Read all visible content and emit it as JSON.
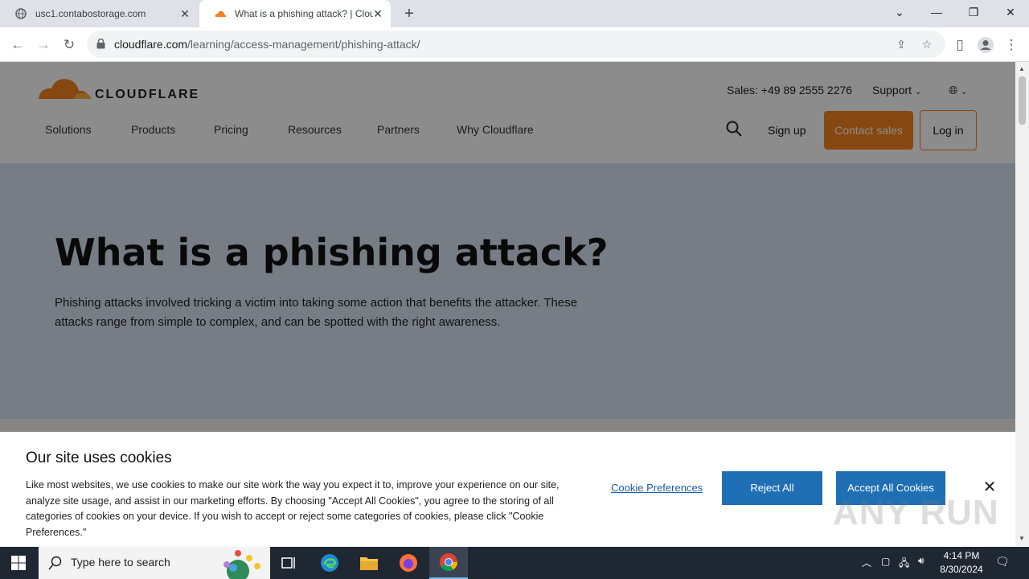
{
  "browser": {
    "tabs": [
      {
        "title": "usc1.contabostorage.com",
        "active": false
      },
      {
        "title": "What is a phishing attack? | Clou",
        "active": true
      }
    ],
    "url_domain": "cloudflare.com",
    "url_path": "/learning/access-management/phishing-attack/"
  },
  "site": {
    "logo_text": "CLOUDFLARE",
    "sales": "Sales: +49 89 2555 2276",
    "support": "Support",
    "nav": [
      "Solutions",
      "Products",
      "Pricing",
      "Resources",
      "Partners",
      "Why Cloudflare"
    ],
    "signup": "Sign up",
    "contact_sales": "Contact sales",
    "login": "Log in",
    "accent_color": "#f6821f"
  },
  "hero": {
    "title": "What is a phishing attack?",
    "description": "Phishing attacks involved tricking a victim into taking some action that benefits the attacker. These attacks range from simple to complex, and can be spotted with the right awareness."
  },
  "cookie_banner": {
    "title": "Our site uses cookies",
    "body": "Like most websites, we use cookies to make our site work the way you expect it to, improve your experience on our site, analyze site usage, and assist in our marketing efforts. By choosing \"Accept All Cookies\", you agree to the storing of all categories of cookies on your device. If you wish to accept or reject some categories of cookies, please click \"Cookie Preferences.\"",
    "preferences": "Cookie Preferences",
    "reject": "Reject All",
    "accept": "Accept All Cookies",
    "button_color": "#1f6fb5"
  },
  "watermark": "ANY RUN",
  "taskbar": {
    "search_placeholder": "Type here to search",
    "time": "4:14 PM",
    "date": "8/30/2024"
  }
}
